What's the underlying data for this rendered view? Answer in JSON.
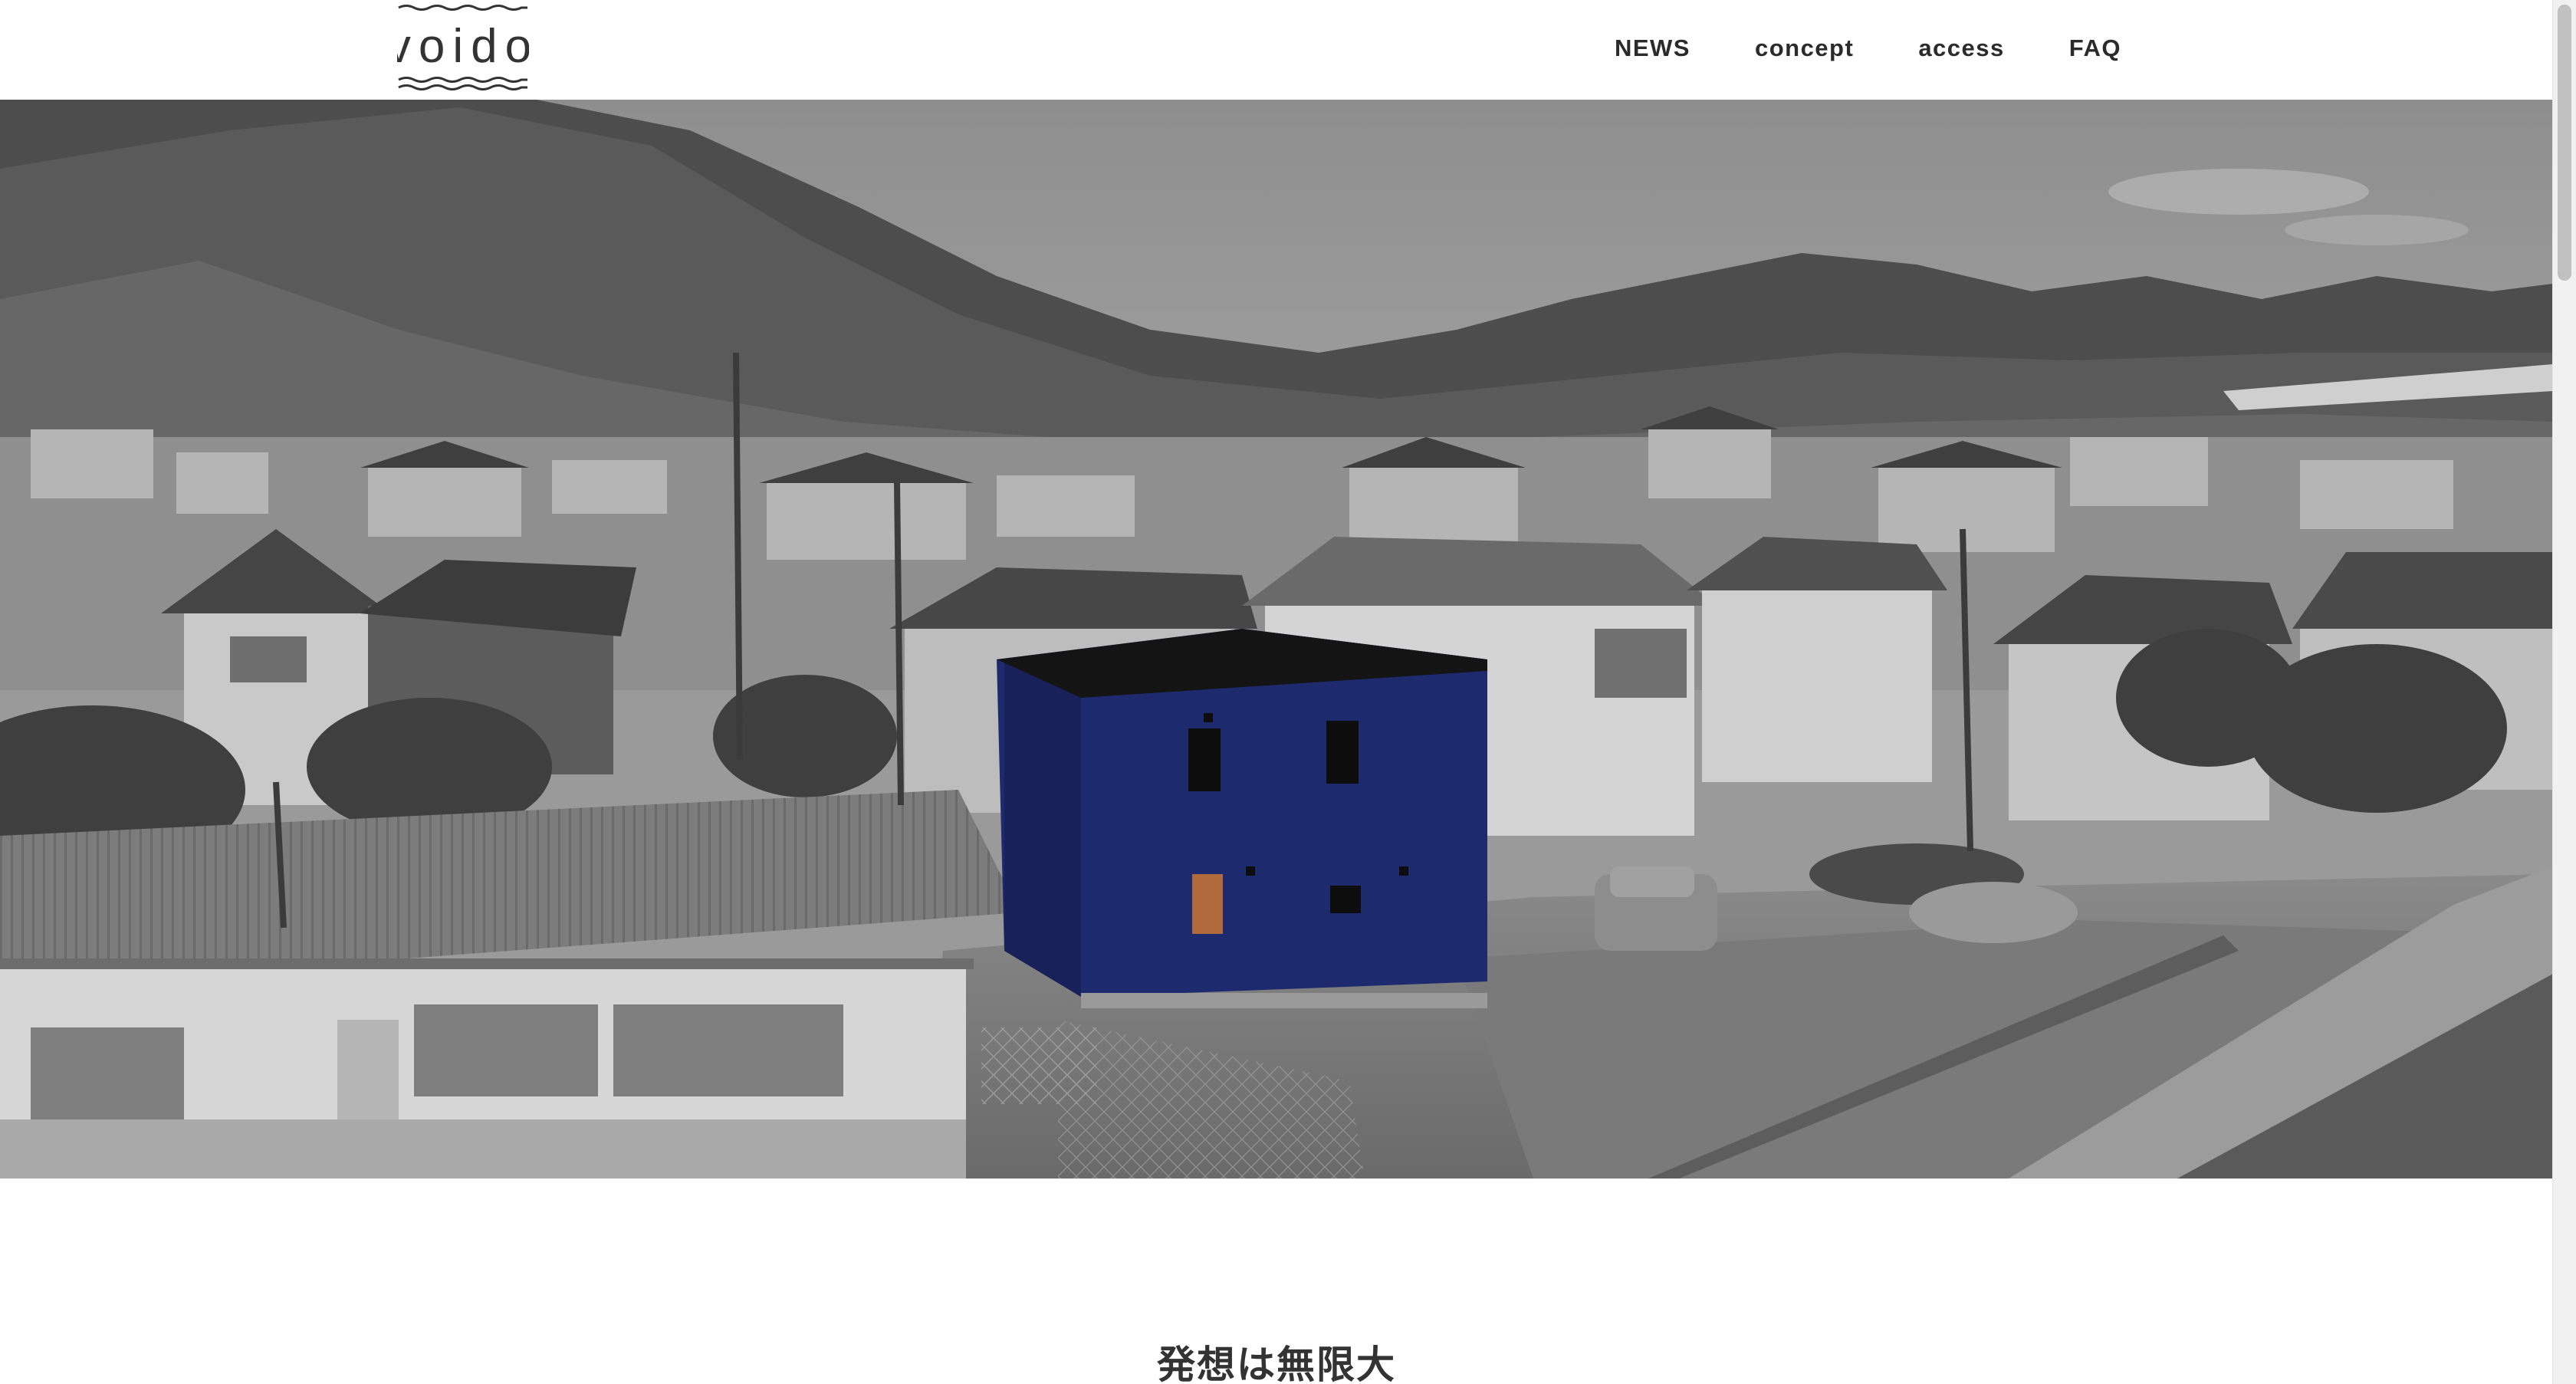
{
  "brand": {
    "logo_text": "voido"
  },
  "nav": {
    "items": [
      {
        "label": "NEWS"
      },
      {
        "label": "concept"
      },
      {
        "label": "access"
      },
      {
        "label": "FAQ"
      }
    ]
  },
  "main": {
    "section_title": "発想は無限大"
  },
  "colors": {
    "text": "#2b2b2b",
    "accent_house": "#1e2a6e",
    "background": "#ffffff"
  }
}
